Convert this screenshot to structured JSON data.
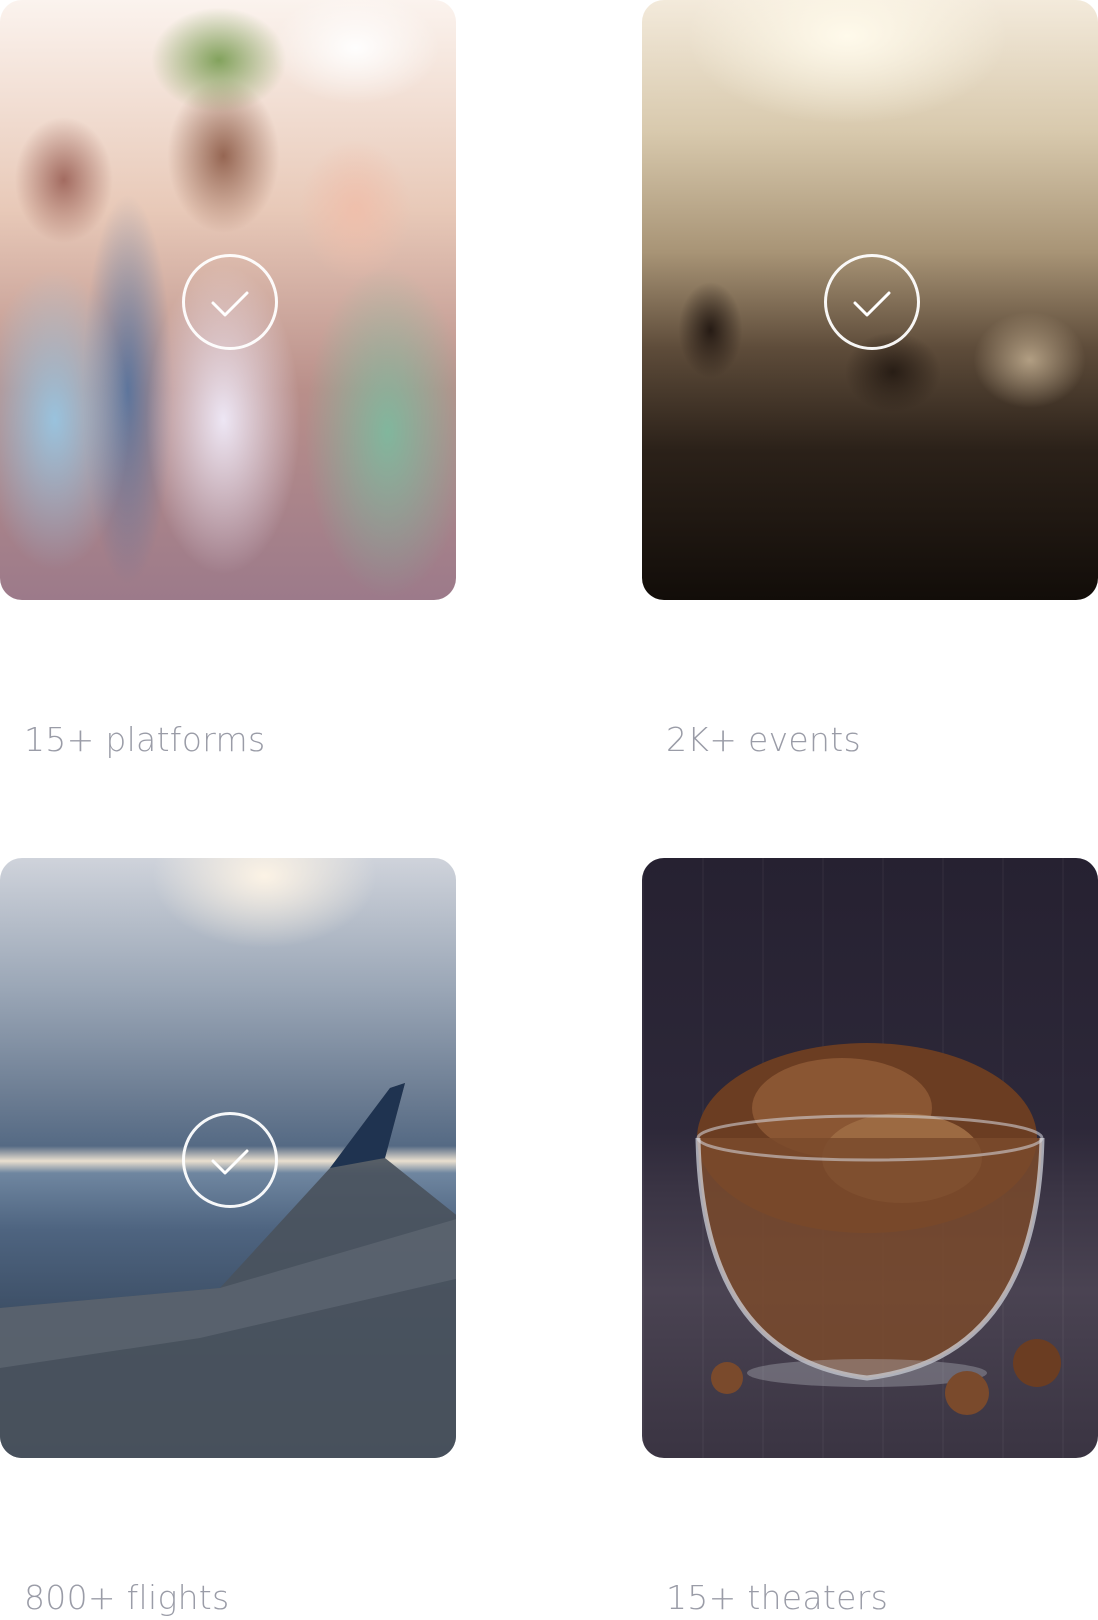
{
  "cards": [
    {
      "caption": "15+ platforms",
      "selected": true,
      "image": "festival-friends-photo"
    },
    {
      "caption": "2K+ events",
      "selected": true,
      "image": "concert-crowd-photo"
    },
    {
      "caption": "800+ flights",
      "selected": true,
      "image": "airplane-wing-photo"
    },
    {
      "caption": "15+ theaters",
      "selected": false,
      "image": "popcorn-bowl-photo"
    }
  ],
  "colors": {
    "caption": "#9a9ca7",
    "check": "#ffffff",
    "background": "#ffffff"
  }
}
